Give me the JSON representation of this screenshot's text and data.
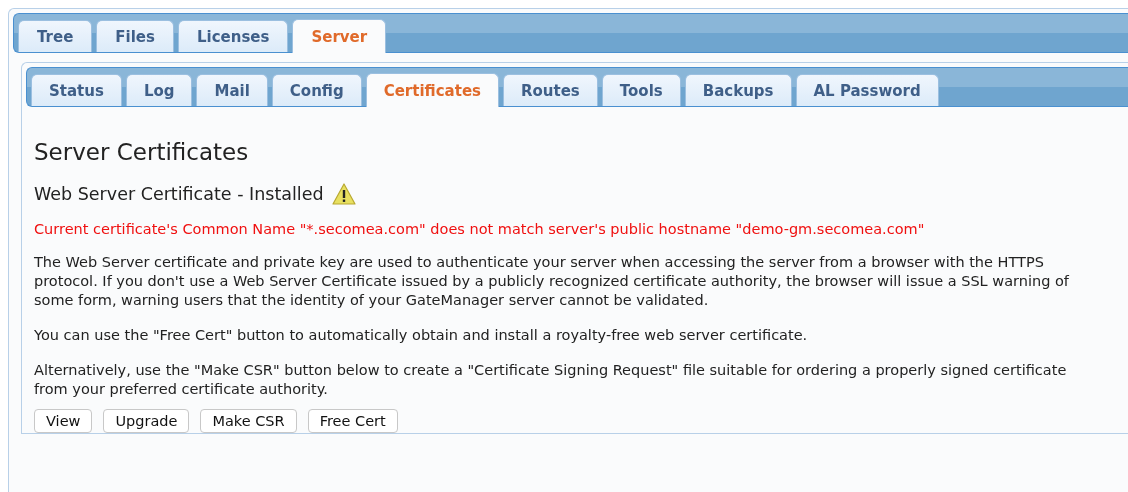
{
  "main_tabs": [
    {
      "label": "Tree",
      "selected": false
    },
    {
      "label": "Files",
      "selected": false
    },
    {
      "label": "Licenses",
      "selected": false
    },
    {
      "label": "Server",
      "selected": true
    }
  ],
  "sub_tabs": [
    {
      "label": "Status",
      "selected": false
    },
    {
      "label": "Log",
      "selected": false
    },
    {
      "label": "Mail",
      "selected": false
    },
    {
      "label": "Config",
      "selected": false
    },
    {
      "label": "Certificates",
      "selected": true
    },
    {
      "label": "Routes",
      "selected": false
    },
    {
      "label": "Tools",
      "selected": false
    },
    {
      "label": "Backups",
      "selected": false
    },
    {
      "label": "AL Password",
      "selected": false
    }
  ],
  "heading": "Server Certificates",
  "subheading": {
    "text": "Web Server Certificate - Installed",
    "warning": true
  },
  "warning_message": "Current certificate's Common Name \"*.secomea.com\" does not match server's public hostname \"demo-gm.secomea.com\"",
  "paragraphs": [
    "The Web Server certificate and private key are used to authenticate your server when accessing the server from a browser with the HTTPS protocol. If you don't use a Web Server Certificate issued by a publicly recognized certificate authority, the browser will issue a SSL warning of some form, warning users that the identity of your GateManager server cannot be validated.",
    "You can use the \"Free Cert\" button to automatically obtain and install a royalty-free web server certificate.",
    "Alternatively, use the \"Make CSR\" button below to create a \"Certificate Signing Request\" file suitable for ordering a properly signed certificate from your preferred certificate authority."
  ],
  "buttons": [
    "View",
    "Upgrade",
    "Make CSR",
    "Free Cert"
  ]
}
